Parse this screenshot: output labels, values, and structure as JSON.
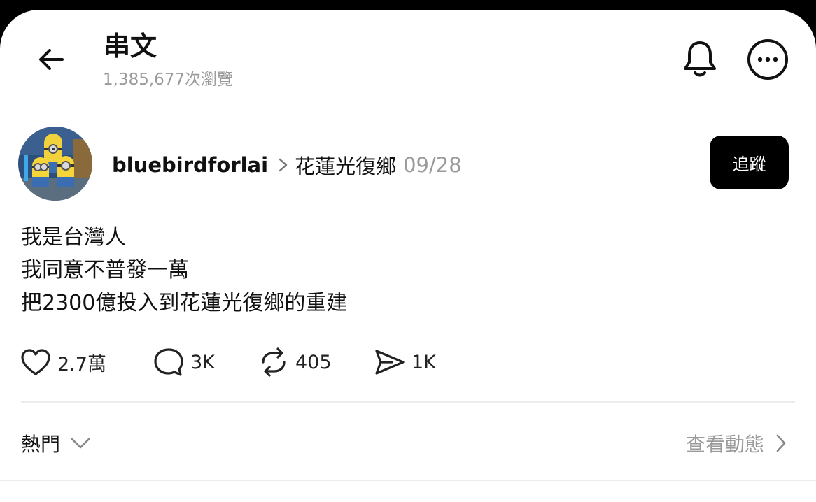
{
  "header": {
    "title": "串文",
    "view_count": "1,385,677次瀏覽"
  },
  "post": {
    "username": "bluebirdforlai",
    "topic": "花蓮光復鄉",
    "date": "09/28",
    "follow_label": "追蹤",
    "lines": [
      "我是台灣人",
      "我同意不普發一萬",
      "把2300億投入到花蓮光復鄉的重建"
    ],
    "stats": {
      "likes": "2.7萬",
      "replies": "3K",
      "reposts": "405",
      "shares": "1K"
    }
  },
  "footer": {
    "sort_label": "熱門",
    "activity_label": "查看動態"
  },
  "icons": {
    "back": "back-arrow-icon",
    "bell": "bell-icon",
    "more": "more-icon",
    "like": "heart-icon",
    "reply": "comment-icon",
    "repost": "repost-icon",
    "share": "send-icon"
  },
  "colors": {
    "follow_bg": "#000000",
    "muted_text": "#9a9a9a"
  }
}
